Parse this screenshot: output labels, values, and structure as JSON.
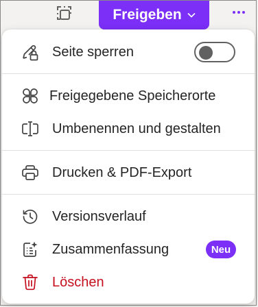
{
  "toolbar": {
    "share_label": "Freigeben",
    "icons": {
      "select": "selection-icon",
      "chevron": "chevron-down-icon",
      "more": "more-icon"
    }
  },
  "menu": {
    "lock_page": {
      "label": "Seite sperren",
      "toggle_on": false
    },
    "shared_locations": {
      "label": "Freigegebene Speicherorte"
    },
    "rename_design": {
      "label": "Umbenennen und gestalten"
    },
    "print_pdf": {
      "label": "Drucken & PDF-Export"
    },
    "version_history": {
      "label": "Versionsverlauf"
    },
    "summary": {
      "label": "Zusammenfassung",
      "badge": "Neu"
    },
    "delete": {
      "label": "Löschen"
    }
  },
  "colors": {
    "accent": "#7b2ff7",
    "danger": "#c50f1f",
    "text": "#242424",
    "divider": "#e1dfdd"
  }
}
